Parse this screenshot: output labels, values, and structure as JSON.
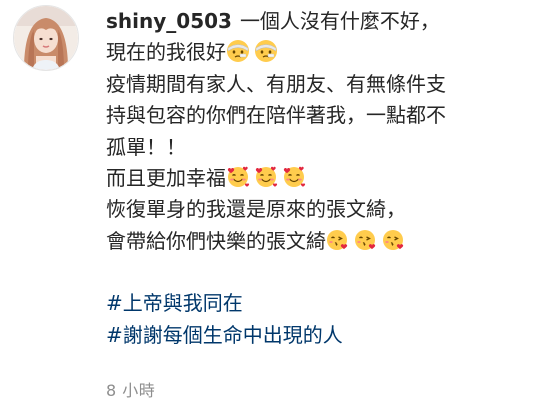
{
  "comment": {
    "username": "shiny_0503",
    "first_line": "一個人沒有什麼不好，",
    "lines": [
      "現在的我很好",
      "疫情期間有家人、有朋友、有無條件支",
      "持與包容的你們在陪伴著我，一點都不",
      "孤單！！",
      "而且更加幸福",
      "恢復單身的我還是原來的張文綺，",
      "會帶給你們快樂的張文綺"
    ],
    "hashtags": [
      "#上帝與我同在",
      "#謝謝每個生命中出現的人"
    ],
    "timestamp": "8 小時"
  },
  "emojis": {
    "line_1": [
      "face-with-head-bandage-icon",
      "face-with-head-bandage-icon"
    ],
    "line_5": [
      "smiling-face-with-hearts-icon",
      "smiling-face-with-hearts-icon",
      "smiling-face-with-hearts-icon"
    ],
    "line_7": [
      "face-blowing-kiss-icon",
      "face-blowing-kiss-icon",
      "face-blowing-kiss-icon"
    ]
  },
  "colors": {
    "text": "#262626",
    "hashtag": "#00376b",
    "timestamp": "#8e8e8e"
  }
}
